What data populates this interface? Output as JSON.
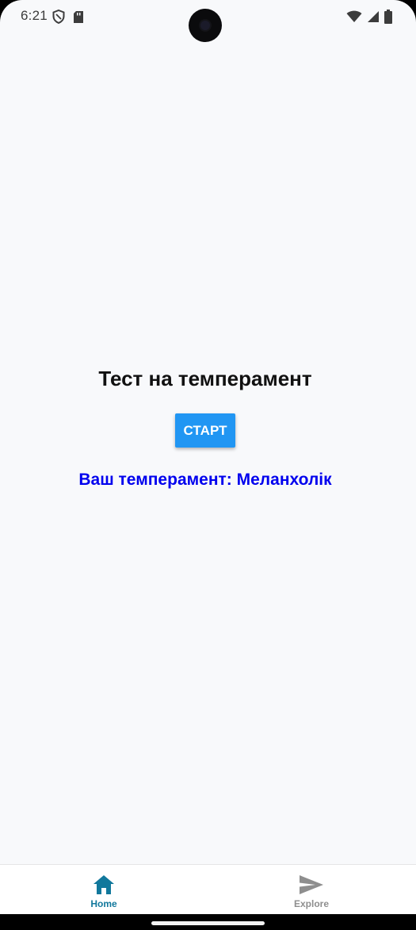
{
  "status_bar": {
    "time": "6:21",
    "left_icons": [
      "shield-icon",
      "sd-card-icon"
    ],
    "right_icons": [
      "wifi-icon",
      "cell-signal-icon",
      "battery-icon"
    ]
  },
  "main": {
    "title": "Тест на темперамент",
    "start_label": "СТАРТ",
    "result_text": "Ваш темперамент: Меланхолік"
  },
  "bottom_nav": {
    "items": [
      {
        "label": "Home",
        "icon": "home-icon",
        "active": true,
        "color": "#11789c"
      },
      {
        "label": "Explore",
        "icon": "send-icon",
        "active": false,
        "color": "#8e8e8e"
      }
    ]
  },
  "colors": {
    "background": "#f8f9fb",
    "button": "#2196f3",
    "result_text": "#0000ee"
  }
}
